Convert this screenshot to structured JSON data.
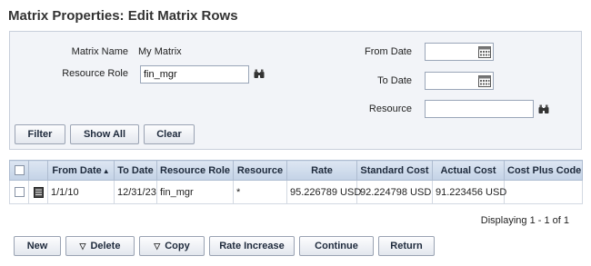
{
  "page": {
    "title": "Matrix Properties: Edit Matrix Rows"
  },
  "filter": {
    "matrix_name_label": "Matrix Name",
    "matrix_name_value": "My Matrix",
    "resource_role_label": "Resource Role",
    "resource_role_value": "fin_mgr",
    "from_date_label": "From Date",
    "from_date_value": "",
    "to_date_label": "To Date",
    "to_date_value": "",
    "resource_label": "Resource",
    "resource_value": "",
    "buttons": {
      "filter": "Filter",
      "show_all": "Show All",
      "clear": "Clear"
    }
  },
  "grid": {
    "columns": [
      "From Date",
      "To Date",
      "Resource Role",
      "Resource",
      "Rate",
      "Standard Cost",
      "Actual Cost",
      "Cost Plus Code"
    ],
    "sort_indicator": "▲",
    "rows": [
      {
        "from_date": "1/1/10",
        "to_date": "12/31/23",
        "resource_role": "fin_mgr",
        "resource": "*",
        "rate": "95.226789 USD",
        "standard_cost": "92.224798 USD",
        "actual_cost": "91.223456 USD",
        "cost_plus_code": ""
      }
    ]
  },
  "pagination": {
    "status": "Displaying 1 - 1 of 1"
  },
  "actions": {
    "new": "New",
    "delete": "Delete",
    "copy": "Copy",
    "rate_increase": "Rate Increase",
    "continue": "Continue",
    "return": "Return"
  },
  "colors": {
    "header_bg": "#c3d2e6",
    "panel_bg": "#f2f4f8",
    "button_border": "#9aa3b3"
  }
}
